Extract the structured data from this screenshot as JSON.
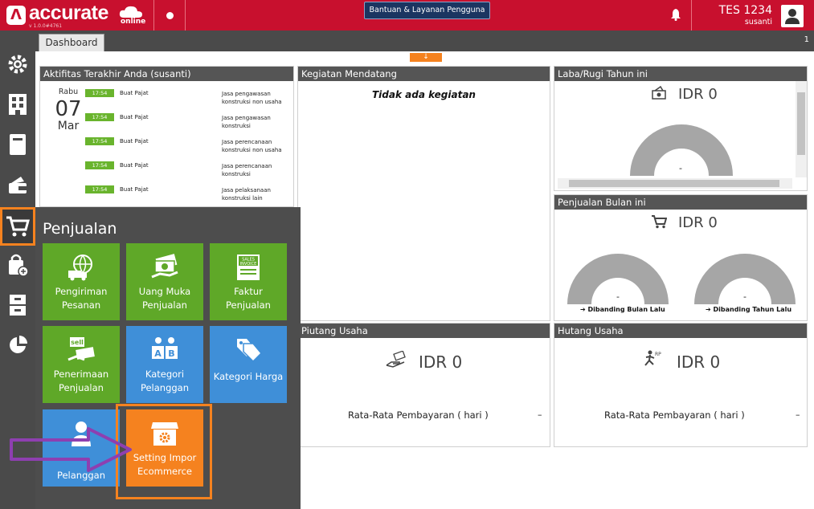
{
  "app": {
    "logo_text": "accurate",
    "logo_sub": "online",
    "version": "v 1.0.0#4761",
    "help_button": "Bantuan & Layanan Pengguna",
    "user_name": "TES 1234",
    "user_sub": "susanti"
  },
  "tabs": {
    "dashboard": "Dashboard",
    "count": "1"
  },
  "activity": {
    "title": "Aktifitas Terakhir Anda (susanti)",
    "day": "Rabu",
    "date": "07",
    "month": "Mar",
    "rows": [
      {
        "time": "17:54",
        "type": "Buat Pajat",
        "desc": "Jasa pengawasan konstruksi non usaha"
      },
      {
        "time": "17:54",
        "type": "Buat Pajat",
        "desc": "Jasa pengawasan konstruksi"
      },
      {
        "time": "17:54",
        "type": "Buat Pajat",
        "desc": "Jasa perencanaan konstruksi non usaha"
      },
      {
        "time": "17:54",
        "type": "Buat Pajat",
        "desc": "Jasa perencanaan konstruksi"
      },
      {
        "time": "17:54",
        "type": "Buat Pajat",
        "desc": "Jasa pelaksanaan konstruksi lain"
      }
    ]
  },
  "upcoming": {
    "title": "Kegiatan Mendatang",
    "empty_text": "Tidak ada kegiatan"
  },
  "profit": {
    "title": "Laba/Rugi Tahun ini",
    "amount": "IDR 0",
    "dash": "-"
  },
  "sales_month": {
    "title": "Penjualan Bulan ini",
    "amount": "IDR 0",
    "left_dash": "-",
    "right_dash": "-",
    "left_caption": "Dibanding Bulan Lalu",
    "right_caption": "Dibanding Tahun Lalu"
  },
  "receivable": {
    "title": "Piutang Usaha",
    "amount": "IDR 0",
    "rate_label": "Rata-Rata Pembayaran ( hari )",
    "rate_value": "–"
  },
  "payable": {
    "title": "Hutang Usaha",
    "amount": "IDR 0",
    "rate_label": "Rata-Rata Pembayaran ( hari )",
    "rate_value": "–"
  },
  "menu": {
    "title": "Penjualan",
    "tiles": [
      {
        "label": "Pengiriman Pesanan",
        "icon": "delivery-globe-icon",
        "color": "#5fa828"
      },
      {
        "label": "Uang Muka Penjualan",
        "icon": "money-hand-icon",
        "color": "#5fa828"
      },
      {
        "label": "Faktur Penjualan",
        "icon": "sales-invoice-icon",
        "color": "#5fa828"
      },
      {
        "label": "Penerimaan Penjualan",
        "icon": "sell-money-icon",
        "color": "#5fa828"
      },
      {
        "label": "Kategori Pelanggan",
        "icon": "ab-blocks-icon",
        "color": "#3f8fd8"
      },
      {
        "label": "Kategori Harga",
        "icon": "price-tags-icon",
        "color": "#3f8fd8"
      },
      {
        "label": "Pelanggan",
        "icon": "customer-icon",
        "color": "#3f8fd8"
      },
      {
        "label": "Setting Impor Ecommerce",
        "icon": "store-gear-icon",
        "color": "#f5821f"
      }
    ],
    "invoice_icon_text": "SALES INVOICE",
    "sell_icon_text": "sell"
  },
  "colors": {
    "brand": "#c8102e",
    "accent": "#f5821f",
    "green": "#5fa828",
    "blue": "#3f8fd8",
    "sidebar": "#4a4a4a"
  }
}
